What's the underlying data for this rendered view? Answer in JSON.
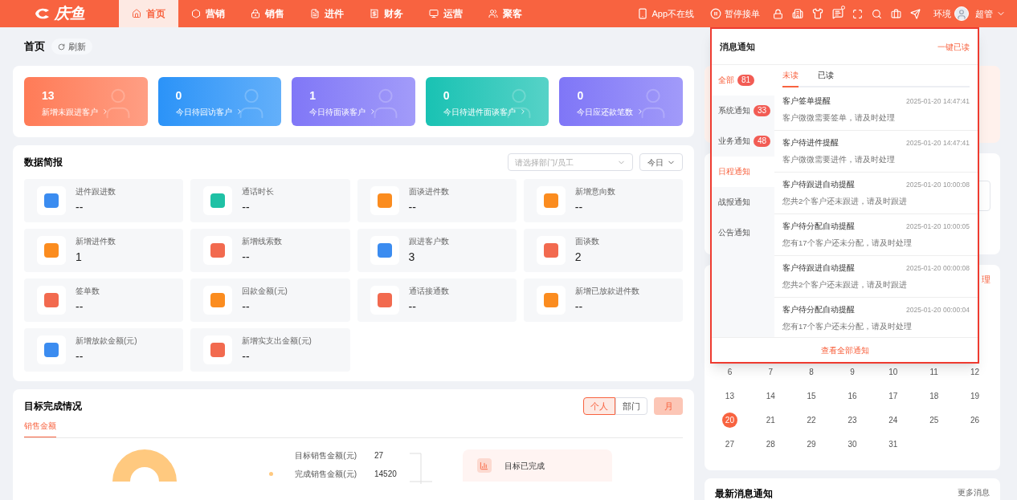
{
  "brand": {
    "name": "庆鱼"
  },
  "nav": [
    {
      "label": "首页",
      "selected": true
    },
    {
      "label": "营销",
      "selected": false
    },
    {
      "label": "销售",
      "selected": false
    },
    {
      "label": "进件",
      "selected": false
    },
    {
      "label": "财务",
      "selected": false
    },
    {
      "label": "运营",
      "selected": false
    },
    {
      "label": "聚客",
      "selected": false
    }
  ],
  "topbar": {
    "app_status": "App不在线",
    "pause": "暂停接单",
    "env": "环境",
    "user": "超管",
    "message_dot": true
  },
  "page": {
    "title": "首页",
    "refresh": "刷新"
  },
  "stat_cards": [
    {
      "value": "13",
      "label": "新增未跟进客户",
      "color": "#ff7b57"
    },
    {
      "value": "0",
      "label": "今日待回访客户",
      "color": "#2b93f8"
    },
    {
      "value": "1",
      "label": "今日待面谈客户",
      "color": "#8077f7"
    },
    {
      "value": "0",
      "label": "今日待进件面谈客户",
      "color": "#19c2b3"
    },
    {
      "value": "0",
      "label": "今日应还款笔数",
      "color": "#7f76f7"
    }
  ],
  "briefing": {
    "title": "数据简报",
    "filter_placeholder": "请选择部门/员工",
    "period": "今日",
    "metrics": [
      {
        "label": "进件跟进数",
        "value": "--",
        "color": "#3b8cf0"
      },
      {
        "label": "通话时长",
        "value": "--",
        "color": "#1fc1a5"
      },
      {
        "label": "面谈进件数",
        "value": "--",
        "color": "#fb8c1f"
      },
      {
        "label": "新增意向数",
        "value": "--",
        "color": "#fb8c1f"
      },
      {
        "label": "新增进件数",
        "value": "1",
        "color": "#fb8c1f"
      },
      {
        "label": "新增线索数",
        "value": "--",
        "color": "#f26a4f"
      },
      {
        "label": "跟进客户数",
        "value": "3",
        "color": "#3b8cf0"
      },
      {
        "label": "面谈数",
        "value": "2",
        "color": "#f26a4f"
      },
      {
        "label": "签单数",
        "value": "--",
        "color": "#f26a4f"
      },
      {
        "label": "回款金额(元)",
        "value": "--",
        "color": "#fb8c1f"
      },
      {
        "label": "通话接通数",
        "value": "--",
        "color": "#f26a4f"
      },
      {
        "label": "新增已放款进件数",
        "value": "--",
        "color": "#fb8c1f"
      },
      {
        "label": "新增放款金额(元)",
        "value": "--",
        "color": "#3b8cf0"
      },
      {
        "label": "新增实支出金额(元)",
        "value": "--",
        "color": "#f26a4f"
      }
    ]
  },
  "targets": {
    "title": "目标完成情况",
    "scopes": [
      {
        "label": "个人",
        "selected": true
      },
      {
        "label": "部门",
        "selected": false
      }
    ],
    "period": "月",
    "tabs": [
      {
        "label": "销售金额",
        "selected": true
      }
    ],
    "rows": [
      {
        "label": "目标销售金额(元)",
        "value": "27",
        "dot": false
      },
      {
        "label": "完成销售金额(元)",
        "value": "14520",
        "dot": true
      }
    ],
    "done_label": "目标已完成"
  },
  "right": {
    "partial_link": "理",
    "calendar": [
      [
        {
          "day": "6",
          "selected": false
        },
        {
          "day": "7",
          "selected": false
        },
        {
          "day": "8",
          "selected": false
        },
        {
          "day": "9",
          "selected": false
        },
        {
          "day": "10",
          "selected": false
        },
        {
          "day": "11",
          "selected": false
        },
        {
          "day": "12",
          "selected": false
        }
      ],
      [
        {
          "day": "13",
          "selected": false
        },
        {
          "day": "14",
          "selected": false
        },
        {
          "day": "15",
          "selected": false
        },
        {
          "day": "16",
          "selected": false
        },
        {
          "day": "17",
          "selected": false
        },
        {
          "day": "18",
          "selected": false
        },
        {
          "day": "19",
          "selected": false
        }
      ],
      [
        {
          "day": "20",
          "selected": true
        },
        {
          "day": "21",
          "selected": false
        },
        {
          "day": "22",
          "selected": false
        },
        {
          "day": "23",
          "selected": false
        },
        {
          "day": "24",
          "selected": false
        },
        {
          "day": "25",
          "selected": false
        },
        {
          "day": "26",
          "selected": false
        }
      ],
      [
        {
          "day": "27",
          "selected": false
        },
        {
          "day": "28",
          "selected": false
        },
        {
          "day": "29",
          "selected": false
        },
        {
          "day": "30",
          "selected": false
        },
        {
          "day": "31",
          "selected": false
        }
      ]
    ],
    "latest_title": "最新消息通知",
    "latest_more": "更多消息"
  },
  "popup": {
    "title": "消息通知",
    "mark_all": "一键已读",
    "categories": [
      {
        "label": "全部",
        "count": "81",
        "selected": true
      },
      {
        "label": "系统通知",
        "count": "33",
        "selected": false
      },
      {
        "label": "业务通知",
        "count": "48",
        "selected": false
      },
      {
        "label": "日程通知",
        "selected": true
      },
      {
        "label": "战报通知",
        "selected": false
      },
      {
        "label": "公告通知",
        "selected": false
      }
    ],
    "tabs": [
      {
        "label": "未读",
        "selected": true
      },
      {
        "label": "已读",
        "selected": false
      }
    ],
    "items": [
      {
        "title": "客户签单提醒",
        "time": "2025-01-20 14:47:41",
        "body": "客户微微需要签单，请及时处理"
      },
      {
        "title": "客户待进件提醒",
        "time": "2025-01-20 14:47:41",
        "body": "客户微微需要进件，请及时处理"
      },
      {
        "title": "客户待跟进自动提醒",
        "time": "2025-01-20 10:00:08",
        "body": "您共2个客户还未跟进，请及时跟进"
      },
      {
        "title": "客户待分配自动提醒",
        "time": "2025-01-20 10:00:05",
        "body": "您有17个客户还未分配，请及时处理"
      },
      {
        "title": "客户待跟进自动提醒",
        "time": "2025-01-20 00:00:08",
        "body": "您共2个客户还未跟进，请及时跟进"
      },
      {
        "title": "客户待分配自动提醒",
        "time": "2025-01-20 00:00:04",
        "body": "您有17个客户还未分配，请及时处理"
      }
    ],
    "footer": "查看全部通知"
  }
}
